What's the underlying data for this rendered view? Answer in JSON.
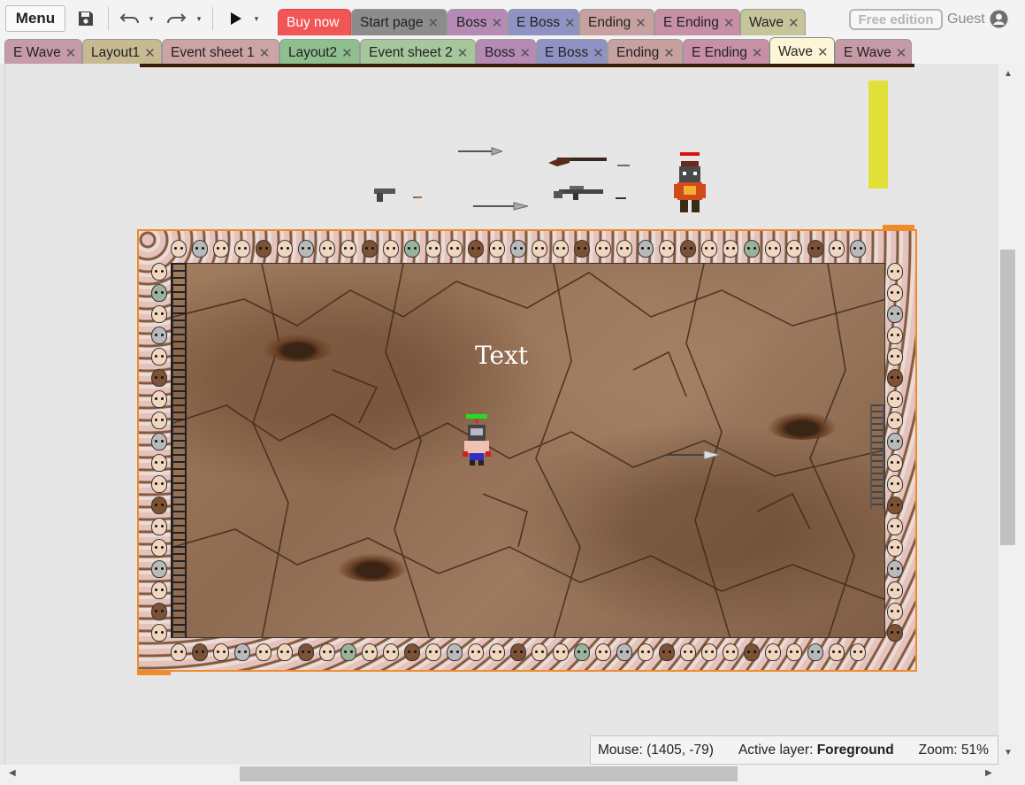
{
  "toolbar": {
    "menu_label": "Menu",
    "save_icon": "floppy-disk-icon",
    "undo_icon": "undo-icon",
    "redo_icon": "redo-icon",
    "play_icon": "play-icon",
    "caret": "▾",
    "free_edition_label": "Free edition",
    "guest_label": "Guest",
    "user_icon": "user-circle-icon"
  },
  "tabs_row1": [
    {
      "label": "Buy now",
      "color": "#f25555",
      "text_color": "#ffffff",
      "closable": false
    },
    {
      "label": "Start page",
      "color": "#8c8c8c",
      "closable": true
    },
    {
      "label": "Boss",
      "color": "#b58bb5",
      "closable": true
    },
    {
      "label": "E Boss",
      "color": "#8f93c3",
      "closable": true
    },
    {
      "label": "Ending",
      "color": "#c7a0a0",
      "closable": true
    },
    {
      "label": "E Ending",
      "color": "#c790a6",
      "closable": true
    },
    {
      "label": "Wave",
      "color": "#c6c49a",
      "closable": true
    }
  ],
  "tabs_row2": [
    {
      "label": "E Wave",
      "color": "#c79aa8"
    },
    {
      "label": "Layout1",
      "color": "#c7ba92"
    },
    {
      "label": "Event sheet 1",
      "color": "#cca4a4"
    },
    {
      "label": "Layout2",
      "color": "#8fbf8f"
    },
    {
      "label": "Event sheet 2",
      "color": "#a6c79c"
    },
    {
      "label": "Boss",
      "color": "#b58bb5"
    },
    {
      "label": "E Boss",
      "color": "#8f93c3"
    },
    {
      "label": "Ending",
      "color": "#c7a0a0"
    },
    {
      "label": "E Ending",
      "color": "#c790a6"
    },
    {
      "label": "Wave",
      "color": "#fdf6d6",
      "active": true
    },
    {
      "label": "E Wave",
      "color": "#c79aa8"
    }
  ],
  "canvas": {
    "text_object": "Text"
  },
  "status": {
    "mouse": "Mouse: (1405, -79)",
    "active_layer_label": "Active layer:",
    "active_layer_value": "Foreground",
    "zoom": "Zoom: 51%"
  },
  "colors": {
    "accent_orange": "#f08a2a",
    "buy_now_red": "#f25555",
    "yellow_marker": "#e0e038"
  }
}
